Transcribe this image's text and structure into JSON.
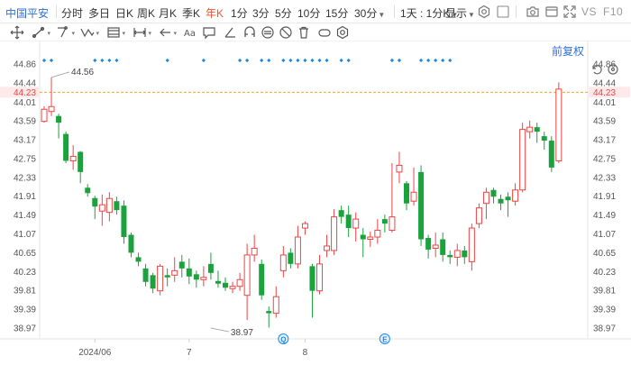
{
  "toolbar": {
    "stock_name": "中国平安",
    "periods": [
      {
        "label": "分时",
        "active": false
      },
      {
        "label": "多日",
        "active": false
      },
      {
        "label": "日K",
        "active": false
      },
      {
        "label": "周K",
        "active": false
      },
      {
        "label": "月K",
        "active": false
      },
      {
        "label": "季K",
        "active": false
      },
      {
        "label": "年K",
        "active": true
      },
      {
        "label": "1分",
        "active": false
      },
      {
        "label": "3分",
        "active": false
      },
      {
        "label": "5分",
        "active": false
      },
      {
        "label": "10分",
        "active": false
      },
      {
        "label": "15分",
        "active": false
      }
    ],
    "dropdown_30": "30分",
    "dropdown_mix": "1天 : 1分K",
    "display_label": "显示",
    "vs_label": "VS",
    "f10_label": "F10"
  },
  "price_adjust_label": "前复权",
  "colors": {
    "up": "#ee4444",
    "down": "#1aa33d",
    "accent": "#2f6fd6",
    "current_line": "#f5a623",
    "current_label": "#ee4444",
    "marker": "#1e88e5"
  },
  "chart_data": {
    "type": "candlestick",
    "ylim": [
      38.97,
      44.86
    ],
    "y_ticks": [
      "44.86",
      "44.44",
      "44.01",
      "43.59",
      "43.17",
      "42.75",
      "42.33",
      "41.91",
      "41.49",
      "41.07",
      "40.65",
      "40.23",
      "39.81",
      "39.39",
      "38.97"
    ],
    "x_labels": [
      {
        "index": 7,
        "text": "2024/06"
      },
      {
        "index": 20,
        "text": "7"
      },
      {
        "index": 36,
        "text": "8"
      }
    ],
    "current_price": 44.23,
    "current_price_label": "44.23",
    "high_annotation": {
      "index": 1,
      "value": 44.56,
      "text": "44.56"
    },
    "low_annotation": {
      "index": 23,
      "value": 38.97,
      "text": "38.97"
    },
    "event_markers": [
      {
        "index": 33,
        "text": "Q"
      },
      {
        "index": 47,
        "text": "E"
      }
    ],
    "candles": [
      {
        "o": 43.58,
        "c": 43.85,
        "h": 43.92,
        "l": 43.55
      },
      {
        "o": 43.8,
        "c": 43.91,
        "h": 44.56,
        "l": 43.7
      },
      {
        "o": 43.7,
        "c": 43.55,
        "h": 43.75,
        "l": 43.2
      },
      {
        "o": 43.3,
        "c": 42.7,
        "h": 43.35,
        "l": 42.65
      },
      {
        "o": 42.7,
        "c": 42.8,
        "h": 43.05,
        "l": 42.5
      },
      {
        "o": 42.9,
        "c": 42.45,
        "h": 42.92,
        "l": 42.2
      },
      {
        "o": 42.1,
        "c": 41.98,
        "h": 42.18,
        "l": 41.9
      },
      {
        "o": 41.87,
        "c": 41.68,
        "h": 41.92,
        "l": 41.4
      },
      {
        "o": 41.58,
        "c": 41.72,
        "h": 41.95,
        "l": 41.25
      },
      {
        "o": 41.55,
        "c": 41.86,
        "h": 42.0,
        "l": 41.35
      },
      {
        "o": 41.8,
        "c": 41.6,
        "h": 41.9,
        "l": 41.5
      },
      {
        "o": 41.7,
        "c": 41.0,
        "h": 41.82,
        "l": 40.85
      },
      {
        "o": 41.05,
        "c": 40.65,
        "h": 41.1,
        "l": 40.55
      },
      {
        "o": 40.55,
        "c": 40.45,
        "h": 40.65,
        "l": 40.35
      },
      {
        "o": 40.3,
        "c": 40.0,
        "h": 40.4,
        "l": 39.9
      },
      {
        "o": 40.15,
        "c": 39.85,
        "h": 40.2,
        "l": 39.75
      },
      {
        "o": 39.8,
        "c": 40.35,
        "h": 40.4,
        "l": 39.7
      },
      {
        "o": 40.15,
        "c": 40.1,
        "h": 40.3,
        "l": 39.9
      },
      {
        "o": 40.15,
        "c": 40.25,
        "h": 40.55,
        "l": 40.0
      },
      {
        "o": 40.45,
        "c": 40.3,
        "h": 40.6,
        "l": 40.1
      },
      {
        "o": 40.3,
        "c": 40.12,
        "h": 40.52,
        "l": 39.95
      },
      {
        "o": 40.17,
        "c": 40.05,
        "h": 40.25,
        "l": 39.87
      },
      {
        "o": 40.05,
        "c": 40.1,
        "h": 40.35,
        "l": 39.9
      },
      {
        "o": 40.4,
        "c": 40.2,
        "h": 40.65,
        "l": 40.05
      },
      {
        "o": 40.02,
        "c": 39.96,
        "h": 40.25,
        "l": 39.87
      },
      {
        "o": 39.98,
        "c": 39.87,
        "h": 40.1,
        "l": 39.8
      },
      {
        "o": 39.85,
        "c": 39.9,
        "h": 40.0,
        "l": 39.75
      },
      {
        "o": 39.9,
        "c": 40.05,
        "h": 40.2,
        "l": 39.8
      },
      {
        "o": 39.7,
        "c": 40.6,
        "h": 40.85,
        "l": 39.15
      },
      {
        "o": 40.6,
        "c": 40.75,
        "h": 41.05,
        "l": 40.45
      },
      {
        "o": 40.4,
        "c": 39.7,
        "h": 40.5,
        "l": 39.6
      },
      {
        "o": 39.35,
        "c": 39.3,
        "h": 39.45,
        "l": 38.98
      },
      {
        "o": 39.3,
        "c": 39.67,
        "h": 39.9,
        "l": 39.2
      },
      {
        "o": 40.25,
        "c": 40.6,
        "h": 40.8,
        "l": 40.1
      },
      {
        "o": 40.65,
        "c": 40.4,
        "h": 40.75,
        "l": 40.3
      },
      {
        "o": 40.4,
        "c": 41.0,
        "h": 41.25,
        "l": 40.3
      },
      {
        "o": 41.2,
        "c": 41.3,
        "h": 41.35,
        "l": 41.05
      },
      {
        "o": 40.35,
        "c": 39.8,
        "h": 40.4,
        "l": 39.2
      },
      {
        "o": 39.8,
        "c": 40.4,
        "h": 40.6,
        "l": 39.72
      },
      {
        "o": 40.7,
        "c": 40.8,
        "h": 41.05,
        "l": 40.55
      },
      {
        "o": 40.7,
        "c": 41.45,
        "h": 41.62,
        "l": 40.6
      },
      {
        "o": 41.6,
        "c": 41.45,
        "h": 41.7,
        "l": 41.3
      },
      {
        "o": 41.5,
        "c": 41.2,
        "h": 41.7,
        "l": 41.0
      },
      {
        "o": 41.2,
        "c": 41.4,
        "h": 41.55,
        "l": 40.9
      },
      {
        "o": 41.05,
        "c": 40.95,
        "h": 41.2,
        "l": 40.55
      },
      {
        "o": 40.95,
        "c": 41.0,
        "h": 41.12,
        "l": 40.78
      },
      {
        "o": 41.0,
        "c": 41.15,
        "h": 41.4,
        "l": 40.85
      },
      {
        "o": 41.4,
        "c": 41.3,
        "h": 41.5,
        "l": 41.1
      },
      {
        "o": 41.15,
        "c": 41.45,
        "h": 42.65,
        "l": 41.1
      },
      {
        "o": 42.45,
        "c": 42.6,
        "h": 42.9,
        "l": 42.2
      },
      {
        "o": 42.2,
        "c": 41.75,
        "h": 42.25,
        "l": 41.6
      },
      {
        "o": 41.8,
        "c": 42.0,
        "h": 42.55,
        "l": 41.7
      },
      {
        "o": 42.45,
        "c": 40.95,
        "h": 42.6,
        "l": 40.8
      },
      {
        "o": 40.98,
        "c": 40.72,
        "h": 41.05,
        "l": 40.52
      },
      {
        "o": 40.75,
        "c": 40.82,
        "h": 41.1,
        "l": 40.55
      },
      {
        "o": 40.95,
        "c": 40.6,
        "h": 41.1,
        "l": 40.45
      },
      {
        "o": 40.6,
        "c": 40.55,
        "h": 40.7,
        "l": 40.4
      },
      {
        "o": 40.55,
        "c": 40.7,
        "h": 40.85,
        "l": 40.35
      },
      {
        "o": 40.7,
        "c": 40.55,
        "h": 40.8,
        "l": 40.4
      },
      {
        "o": 40.45,
        "c": 41.2,
        "h": 41.3,
        "l": 40.25
      },
      {
        "o": 41.3,
        "c": 41.65,
        "h": 41.75,
        "l": 41.2
      },
      {
        "o": 41.75,
        "c": 42.0,
        "h": 42.1,
        "l": 41.4
      },
      {
        "o": 42.05,
        "c": 41.9,
        "h": 42.1,
        "l": 41.75
      },
      {
        "o": 41.85,
        "c": 41.75,
        "h": 41.95,
        "l": 41.6
      },
      {
        "o": 41.9,
        "c": 41.82,
        "h": 42.0,
        "l": 41.45
      },
      {
        "o": 41.8,
        "c": 42.05,
        "h": 42.2,
        "l": 41.7
      },
      {
        "o": 42.05,
        "c": 43.4,
        "h": 43.55,
        "l": 42.0
      },
      {
        "o": 43.35,
        "c": 43.45,
        "h": 43.6,
        "l": 43.2
      },
      {
        "o": 43.45,
        "c": 43.35,
        "h": 43.55,
        "l": 43.1
      },
      {
        "o": 43.25,
        "c": 43.15,
        "h": 43.35,
        "l": 42.95
      },
      {
        "o": 43.15,
        "c": 42.55,
        "h": 43.25,
        "l": 42.45
      },
      {
        "o": 42.7,
        "c": 44.3,
        "h": 44.45,
        "l": 42.65
      }
    ]
  }
}
